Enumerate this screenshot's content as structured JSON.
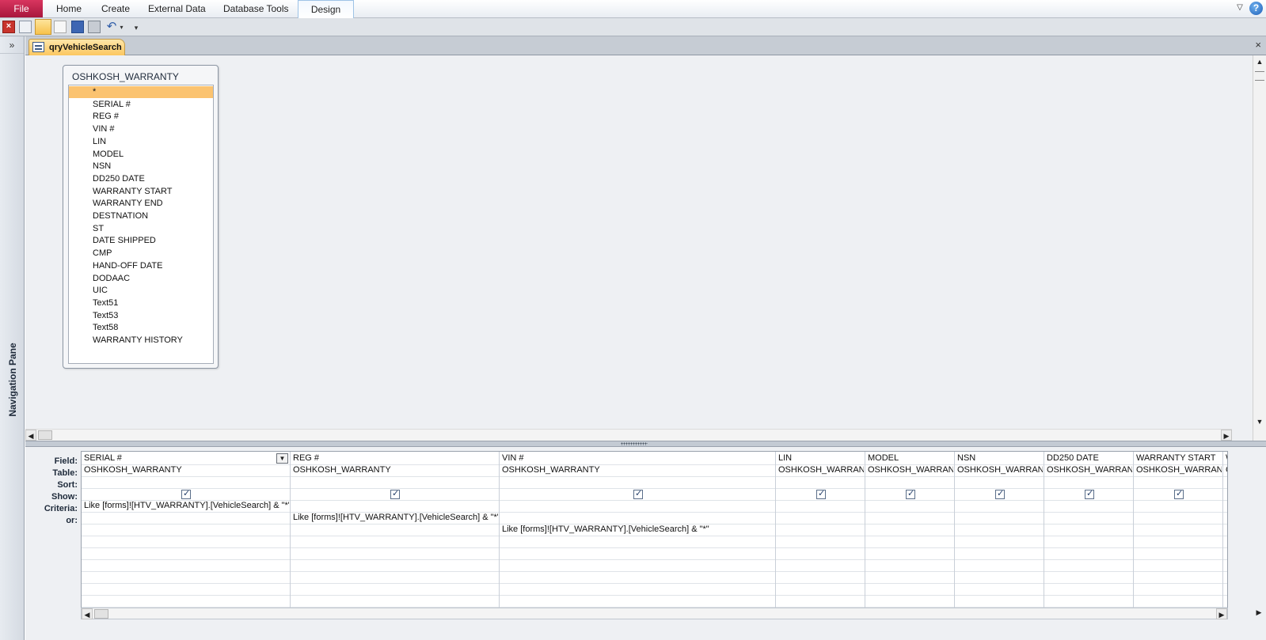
{
  "ribbon": {
    "file_label": "File",
    "tabs": [
      "Home",
      "Create",
      "External Data",
      "Database Tools"
    ],
    "active_tab": "Design",
    "help_label": "?"
  },
  "quick_access": {
    "icons": [
      "close-icon",
      "form-view-icon",
      "design-view-icon",
      "print-preview-icon",
      "save-icon",
      "print-icon",
      "undo-icon",
      "undo-dropdown-icon",
      "customize-qat-icon"
    ]
  },
  "nav_pane": {
    "toggle": "»",
    "label": "Navigation Pane"
  },
  "document": {
    "tab_label": "qryVehicleSearch",
    "close": "×"
  },
  "field_list": {
    "title": "OSHKOSH_WARRANTY",
    "items": [
      "*",
      "SERIAL #",
      "REG #",
      "VIN #",
      "LIN",
      "MODEL",
      "NSN",
      "DD250 DATE",
      "WARRANTY START",
      "WARRANTY END",
      "DESTNATION",
      "ST",
      "DATE SHIPPED",
      "CMP",
      "HAND-OFF DATE",
      "DODAAC",
      "UIC",
      "Text51",
      "Text53",
      "Text58",
      "WARRANTY HISTORY"
    ],
    "selected_index": 0
  },
  "grid": {
    "row_labels": [
      "Field:",
      "Table:",
      "Sort:",
      "Show:",
      "Criteria:",
      "or:"
    ],
    "columns": [
      {
        "field": "SERIAL #",
        "table": "OSHKOSH_WARRANTY",
        "sort": "",
        "show": true,
        "criteria": "Like [forms]![HTV_WARRANTY].[VehicleSearch] & \"*\"",
        "or": "",
        "or2": ""
      },
      {
        "field": "REG #",
        "table": "OSHKOSH_WARRANTY",
        "sort": "",
        "show": true,
        "criteria": "",
        "or": "Like [forms]![HTV_WARRANTY].[VehicleSearch] & \"*\"",
        "or2": ""
      },
      {
        "field": "VIN #",
        "table": "OSHKOSH_WARRANTY",
        "sort": "",
        "show": true,
        "criteria": "",
        "or": "",
        "or2": "Like [forms]![HTV_WARRANTY].[VehicleSearch] & \"*\""
      },
      {
        "field": "LIN",
        "table": "OSHKOSH_WARRANT",
        "sort": "",
        "show": true,
        "criteria": "",
        "or": "",
        "or2": ""
      },
      {
        "field": "MODEL",
        "table": "OSHKOSH_WARRANT",
        "sort": "",
        "show": true,
        "criteria": "",
        "or": "",
        "or2": ""
      },
      {
        "field": "NSN",
        "table": "OSHKOSH_WARRANT",
        "sort": "",
        "show": true,
        "criteria": "",
        "or": "",
        "or2": ""
      },
      {
        "field": "DD250 DATE",
        "table": "OSHKOSH_WARRANT",
        "sort": "",
        "show": true,
        "criteria": "",
        "or": "",
        "or2": ""
      },
      {
        "field": "WARRANTY START",
        "table": "OSHKOSH_WARRANT",
        "sort": "",
        "show": true,
        "criteria": "",
        "or": "",
        "or2": ""
      },
      {
        "field": "WA",
        "table": "OS",
        "sort": "",
        "show": false,
        "criteria": "",
        "or": "",
        "or2": ""
      }
    ]
  }
}
